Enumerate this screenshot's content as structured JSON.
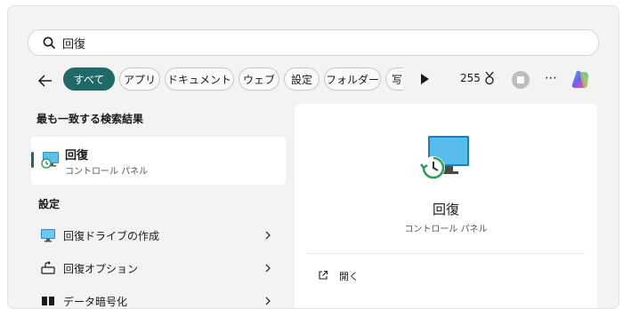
{
  "search": {
    "query": "回復"
  },
  "filters": [
    {
      "label": "すべて",
      "active": true
    },
    {
      "label": "アプリ",
      "active": false
    },
    {
      "label": "ドキュメント",
      "active": false
    },
    {
      "label": "ウェブ",
      "active": false
    },
    {
      "label": "設定",
      "active": false
    },
    {
      "label": "フォルダー",
      "active": false
    },
    {
      "label": "写",
      "active": false
    }
  ],
  "toolbar": {
    "points": "255"
  },
  "best_match": {
    "heading": "最も一致する検索結果",
    "title": "回復",
    "subtitle": "コントロール パネル"
  },
  "settings_section": {
    "heading": "設定",
    "items": [
      {
        "label": "回復ドライブの作成",
        "icon": "monitor-icon"
      },
      {
        "label": "回復オプション",
        "icon": "recovery-options-icon"
      },
      {
        "label": "データ暗号化",
        "icon": "encryption-icon"
      }
    ]
  },
  "detail": {
    "title": "回復",
    "subtitle": "コントロール パネル",
    "open_label": "開く"
  },
  "colors": {
    "accent": "#1f6a67"
  }
}
